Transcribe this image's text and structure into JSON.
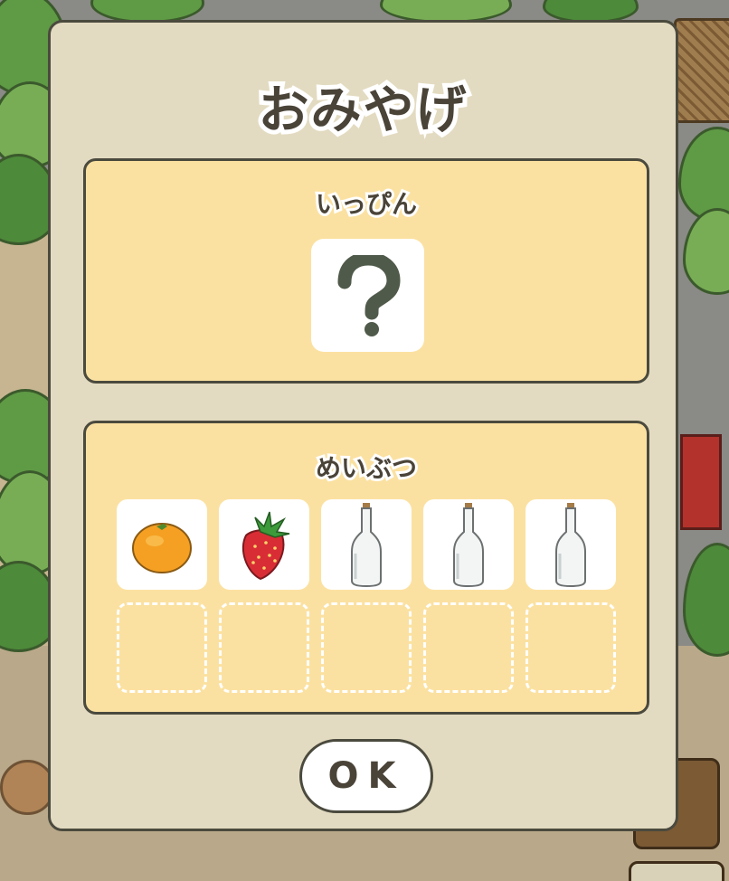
{
  "dialog": {
    "title": "おみやげ",
    "special_section": {
      "label": "いっぴん",
      "item": {
        "icon": "question-mark-icon",
        "label": "?"
      }
    },
    "specialty_section": {
      "label": "めいぶつ",
      "slots": [
        {
          "icon": "orange-icon"
        },
        {
          "icon": "strawberry-icon"
        },
        {
          "icon": "glass-bottle-icon"
        },
        {
          "icon": "glass-bottle-icon"
        },
        {
          "icon": "glass-bottle-icon"
        },
        {
          "icon": "empty-slot"
        },
        {
          "icon": "empty-slot"
        },
        {
          "icon": "empty-slot"
        },
        {
          "icon": "empty-slot"
        },
        {
          "icon": "empty-slot"
        }
      ]
    },
    "ok_label": "OK"
  },
  "colors": {
    "dialog_bg": "#e3dbc1",
    "panel_bg": "#fbe1a1",
    "outline": "#4b4a3e",
    "text": "#4a4338"
  }
}
